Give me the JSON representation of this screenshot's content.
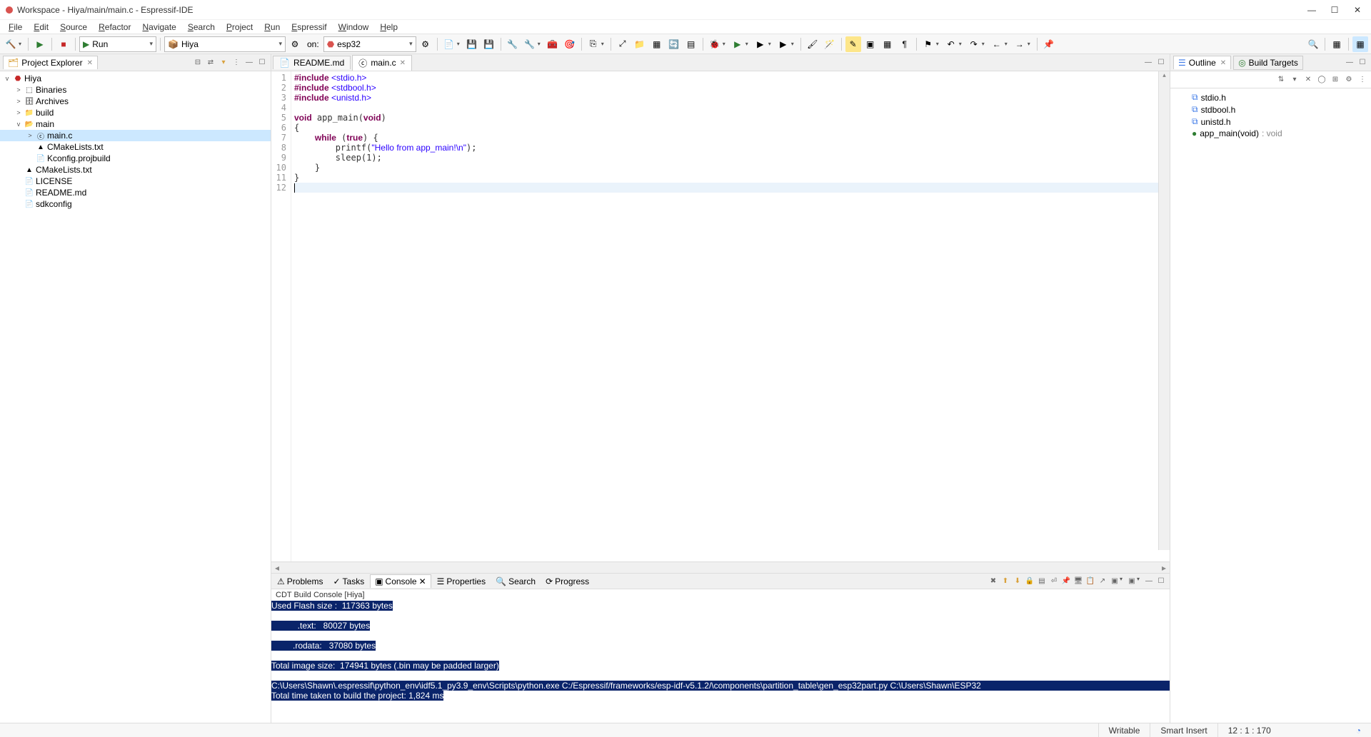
{
  "window": {
    "title": "Workspace - Hiya/main/main.c - Espressif-IDE"
  },
  "menu": [
    "File",
    "Edit",
    "Source",
    "Refactor",
    "Navigate",
    "Search",
    "Project",
    "Run",
    "Espressif",
    "Window",
    "Help"
  ],
  "runCombo": "Run",
  "projCombo": "Hiya",
  "onLabel": "on:",
  "targetCombo": "esp32",
  "explorer": {
    "title": "Project Explorer",
    "root": "Hiya",
    "items": [
      {
        "indent": 1,
        "exp": ">",
        "icon": "binaries",
        "label": "Binaries"
      },
      {
        "indent": 1,
        "exp": ">",
        "icon": "archives",
        "label": "Archives"
      },
      {
        "indent": 1,
        "exp": ">",
        "icon": "folder",
        "label": "build"
      },
      {
        "indent": 1,
        "exp": "v",
        "icon": "folder-open",
        "label": "main"
      },
      {
        "indent": 2,
        "exp": ">",
        "icon": "cfile",
        "label": "main.c",
        "sel": true
      },
      {
        "indent": 2,
        "exp": "",
        "icon": "cmake",
        "label": "CMakeLists.txt"
      },
      {
        "indent": 2,
        "exp": "",
        "icon": "file",
        "label": "Kconfig.projbuild"
      },
      {
        "indent": 1,
        "exp": "",
        "icon": "cmake",
        "label": "CMakeLists.txt"
      },
      {
        "indent": 1,
        "exp": "",
        "icon": "file",
        "label": "LICENSE"
      },
      {
        "indent": 1,
        "exp": "",
        "icon": "file",
        "label": "README.md"
      },
      {
        "indent": 1,
        "exp": "",
        "icon": "file",
        "label": "sdkconfig"
      }
    ]
  },
  "editorTabs": [
    {
      "label": "README.md",
      "active": false,
      "icon": "file"
    },
    {
      "label": "main.c",
      "active": true,
      "icon": "cfile"
    }
  ],
  "code": {
    "lines": [
      [
        {
          "t": "#include ",
          "c": "inc"
        },
        {
          "t": "<stdio.h>",
          "c": "inch"
        }
      ],
      [
        {
          "t": "#include ",
          "c": "inc"
        },
        {
          "t": "<stdbool.h>",
          "c": "inch"
        }
      ],
      [
        {
          "t": "#include ",
          "c": "inc"
        },
        {
          "t": "<unistd.h>",
          "c": "inch"
        }
      ],
      [
        {
          "t": "",
          "c": ""
        }
      ],
      [
        {
          "t": "void",
          "c": "kw"
        },
        {
          "t": " app_main(",
          "c": ""
        },
        {
          "t": "void",
          "c": "kw"
        },
        {
          "t": ")",
          "c": ""
        }
      ],
      [
        {
          "t": "{",
          "c": ""
        }
      ],
      [
        {
          "t": "    ",
          "c": ""
        },
        {
          "t": "while",
          "c": "kw"
        },
        {
          "t": " (",
          "c": ""
        },
        {
          "t": "true",
          "c": "kw"
        },
        {
          "t": ") {",
          "c": ""
        }
      ],
      [
        {
          "t": "        printf(",
          "c": ""
        },
        {
          "t": "\"Hello from app_main!\\n\"",
          "c": "str"
        },
        {
          "t": ");",
          "c": ""
        }
      ],
      [
        {
          "t": "        sleep(1);",
          "c": ""
        }
      ],
      [
        {
          "t": "    }",
          "c": ""
        }
      ],
      [
        {
          "t": "}",
          "c": ""
        }
      ],
      [
        {
          "t": "",
          "c": "",
          "cur": true
        }
      ]
    ]
  },
  "bottomTabs": [
    "Problems",
    "Tasks",
    "Console",
    "Properties",
    "Search",
    "Progress"
  ],
  "consoleTitle": "CDT Build Console [Hiya]",
  "consoleLines": [
    {
      "t": "Used Flash size :  117363 bytes",
      "hl": true
    },
    {
      "t": "",
      "hl": false
    },
    {
      "t": "           .text:   80027 bytes",
      "hl": true,
      "pad": true
    },
    {
      "t": "",
      "hl": false
    },
    {
      "t": "         .rodata:   37080 bytes",
      "hl": true,
      "pad": true
    },
    {
      "t": "",
      "hl": false
    },
    {
      "t": "Total image size:  174941 bytes (.bin may be padded larger)",
      "hl": true
    },
    {
      "t": "",
      "hl": false
    },
    {
      "t": "C:\\Users\\Shawn\\.espressif\\python_env\\idf5.1_py3.9_env\\Scripts\\python.exe C:/Espressif/frameworks/esp-idf-v5.1.2/\\components\\partition_table\\gen_esp32part.py C:\\Users\\Shawn\\ESP32",
      "hl": true,
      "full": true
    },
    {
      "t": "Total time taken to build the project: 1,824 ms",
      "hl": true
    }
  ],
  "outline": {
    "tab1": "Outline",
    "tab2": "Build Targets",
    "items": [
      {
        "icon": "hdr",
        "label": "stdio.h"
      },
      {
        "icon": "hdr",
        "label": "stdbool.h"
      },
      {
        "icon": "hdr",
        "label": "unistd.h"
      },
      {
        "icon": "fn",
        "label": "app_main(void)",
        "ret": " : void"
      }
    ]
  },
  "status": {
    "writable": "Writable",
    "insert": "Smart Insert",
    "pos": "12 : 1 : 170"
  }
}
